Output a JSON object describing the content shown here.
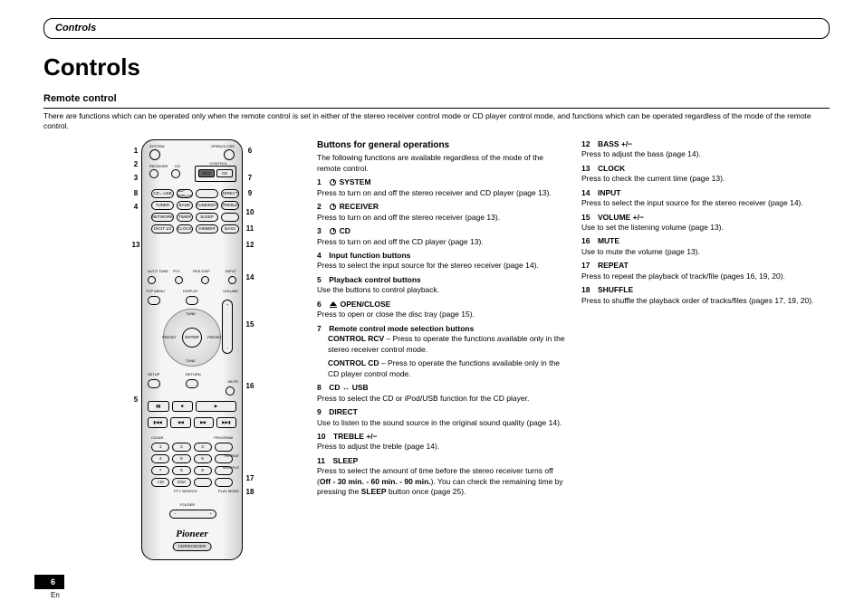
{
  "header": {
    "breadcrumb": "Controls"
  },
  "page": {
    "title": "Controls",
    "section_title": "Remote control",
    "intro": "There are functions which can be operated only when the remote control is set in either of the stereo receiver control mode or CD player control mode, and functions which can be operated regardless of the mode of the remote control.",
    "page_number": "6",
    "lang": "En"
  },
  "remote": {
    "brand": "Pioneer",
    "model_badge": "CD/RECEIVER",
    "callouts_left": [
      "1",
      "2",
      "3",
      "4",
      "5",
      "6",
      "7",
      "8",
      "9"
    ],
    "callouts_right": [
      "10",
      "11",
      "12",
      "13",
      "14",
      "15",
      "16",
      "17",
      "18"
    ],
    "buttons": {
      "system": "SYSTEM",
      "openclose": "OPEN/CLOSE",
      "receiver": "RECEIVER",
      "cd": "CD",
      "control": "CONTROL",
      "rcv": "RCV",
      "cdusb": "CD↔USB",
      "cdrplay": "CD-R/PLAY",
      "direct": "DIRECT",
      "tuner": "TUNER",
      "band": "BAND",
      "tuneedit": "TUNE/EDIT",
      "treble": "TREBLE",
      "network": "NETWORK",
      "timer": "TIMER",
      "sleep": "SLEEP",
      "digit12": "DIGIT 1/2",
      "clock": "CLOCK",
      "dimmer": "DIMMER",
      "bass": "BASS",
      "autotune": "AUTO TUNE",
      "ptx": "PTX",
      "rdsdisp": "RDS DISP",
      "input": "INPUT",
      "topmenu": "TOP MENU",
      "display": "DISPLAY",
      "volume": "VOLUME",
      "tune": "TUNE",
      "preset": "PRESET",
      "enter": "ENTER",
      "setup": "SETUP",
      "return": "RETURN",
      "mute": "MUTE",
      "clear": "CLEAR",
      "program": "PROGRAM",
      "repeat": "REPEAT",
      "shuffle": "SHUFFLE",
      "plus10": "+10",
      "zero_10": "0/10",
      "ptysearch": "PTY SEARCH",
      "playmode": "PLAY MODE",
      "folder": "FOLDER"
    }
  },
  "col1": {
    "heading": "Buttons for general operations",
    "intro": "The following functions are available regardless of the mode of the remote control.",
    "items": [
      {
        "head_num": "1",
        "head_icon": "power",
        "head_text": "SYSTEM",
        "body": "Press to turn on and off the stereo receiver and CD player (page 13)."
      },
      {
        "head_num": "2",
        "head_icon": "power",
        "head_text": "RECEIVER",
        "body": "Press to turn on and off the stereo receiver (page 13)."
      },
      {
        "head_num": "3",
        "head_icon": "power",
        "head_text": "CD",
        "body": "Press to turn on and off the CD player (page 13)."
      },
      {
        "head_num": "4",
        "head_text": "Input function buttons",
        "body": "Press to select the input source for the stereo receiver (page 14)."
      },
      {
        "head_num": "5",
        "head_text": "Playback control buttons",
        "body": "Use the buttons to control playback."
      },
      {
        "head_num": "6",
        "head_icon": "eject",
        "head_text": "OPEN/CLOSE",
        "body": "Press to open or close the disc tray (page 15)."
      },
      {
        "head_num": "7",
        "head_text": "Remote control mode selection buttons",
        "body": "",
        "subs": [
          {
            "b": "CONTROL RCV",
            "t": " – Press to operate the functions available only in the stereo receiver control mode."
          },
          {
            "b": "CONTROL CD",
            "t": " – Press to operate the functions available only in the CD player control mode."
          }
        ]
      },
      {
        "head_num": "8",
        "head_text_pre": "CD",
        "head_swap": "↔",
        "head_text_post": "USB",
        "body": "Press to select the CD or iPod/USB function for the CD player."
      },
      {
        "head_num": "9",
        "head_text": "DIRECT",
        "body": "Use to listen to the sound source in the original sound quality (page 14)."
      },
      {
        "head_num": "10",
        "head_text": "TREBLE +/−",
        "body": "Press to adjust the treble (page 14)."
      },
      {
        "head_num": "11",
        "head_text": "SLEEP",
        "body_parts": [
          "Press to select the amount of time before the stereo receiver turns off (",
          "Off - 30 min. - 60 min. - 90 min.",
          "). You can check the remaining time by pressing the ",
          "SLEEP",
          " button once (page 25)."
        ]
      }
    ]
  },
  "col2": {
    "items": [
      {
        "head_num": "12",
        "head_text": "BASS +/−",
        "body": "Press to adjust the bass (page 14)."
      },
      {
        "head_num": "13",
        "head_text": "CLOCK",
        "body": "Press to check the current time (page 13)."
      },
      {
        "head_num": "14",
        "head_text": "INPUT",
        "body": "Press to select the input source for the stereo receiver (page 14)."
      },
      {
        "head_num": "15",
        "head_text": "VOLUME +/−",
        "body": "Use to set the listening volume (page 13)."
      },
      {
        "head_num": "16",
        "head_text": "MUTE",
        "body": "Use to mute the volume (page 13)."
      },
      {
        "head_num": "17",
        "head_text": "REPEAT",
        "body": "Press to repeat the playback of track/file (pages 16, 19, 20)."
      },
      {
        "head_num": "18",
        "head_text": "SHUFFLE",
        "body": "Press to shuffle the playback order of tracks/files (pages 17, 19, 20)."
      }
    ]
  }
}
